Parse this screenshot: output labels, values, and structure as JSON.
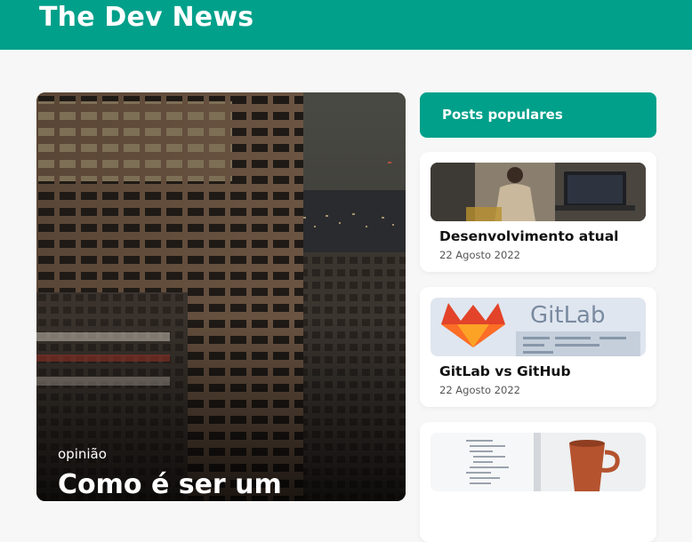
{
  "header": {
    "brand": "The Dev News"
  },
  "hero": {
    "category": "opinião",
    "title": "Como é ser um"
  },
  "sidebar": {
    "title": "Posts populares",
    "posts": [
      {
        "title": "Desenvolvimento atual",
        "date": "22 Agosto 2022"
      },
      {
        "title": "GitLab vs GitHub",
        "date": "22 Agosto 2022"
      },
      {
        "title": "",
        "date": ""
      }
    ]
  },
  "colors": {
    "accent": "#00a08a",
    "background": "#f7f7f7",
    "card": "#ffffff"
  },
  "images": {
    "gitlab_logo_text": "GitLab"
  }
}
